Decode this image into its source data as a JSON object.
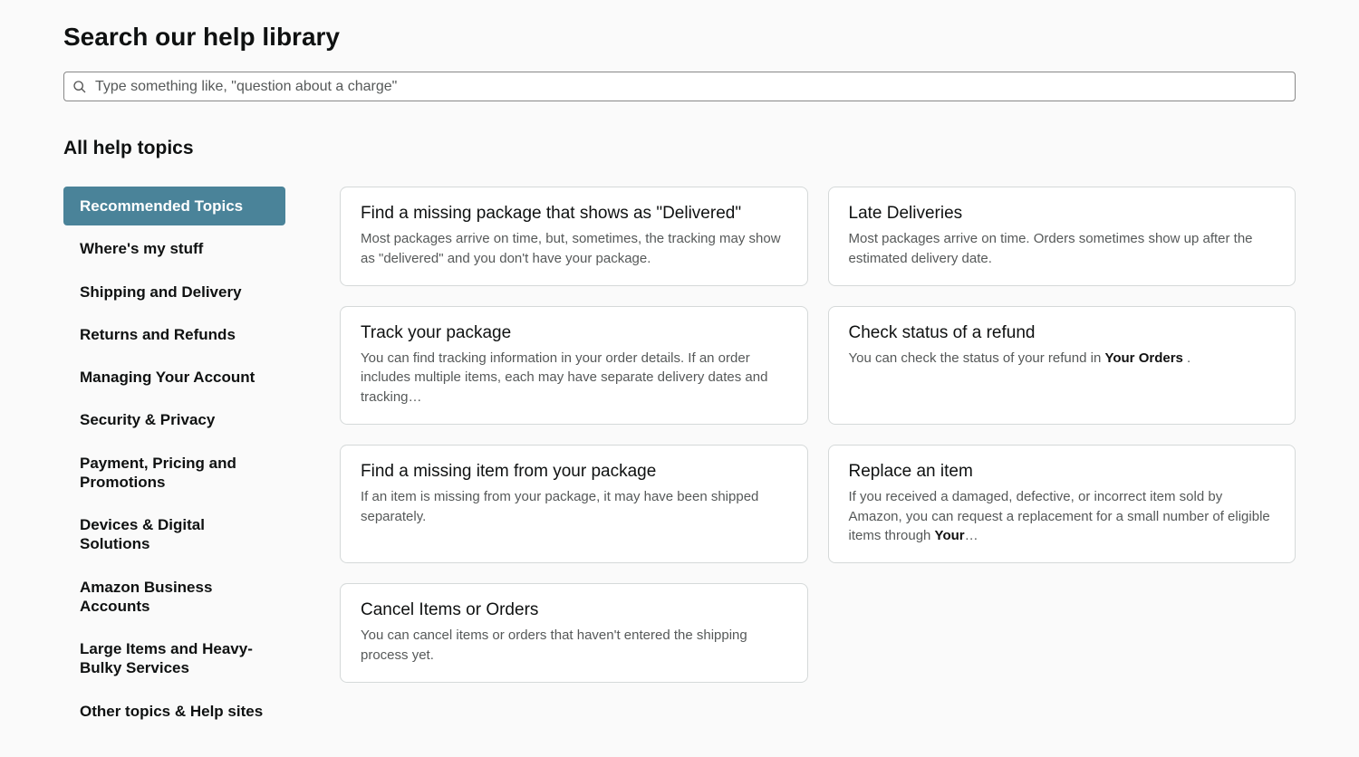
{
  "header": {
    "title": "Search our help library"
  },
  "search": {
    "placeholder": "Type something like, \"question about a charge\""
  },
  "section_title": "All help topics",
  "sidebar": {
    "items": [
      {
        "label": "Recommended Topics",
        "active": true
      },
      {
        "label": "Where's my stuff",
        "active": false
      },
      {
        "label": "Shipping and Delivery",
        "active": false
      },
      {
        "label": "Returns and Refunds",
        "active": false
      },
      {
        "label": "Managing Your Account",
        "active": false
      },
      {
        "label": "Security & Privacy",
        "active": false
      },
      {
        "label": "Payment, Pricing and Promotions",
        "active": false
      },
      {
        "label": "Devices & Digital Solutions",
        "active": false
      },
      {
        "label": "Amazon Business Accounts",
        "active": false
      },
      {
        "label": "Large Items and Heavy-Bulky Services",
        "active": false
      },
      {
        "label": "Other topics & Help sites",
        "active": false
      }
    ]
  },
  "cards": [
    {
      "title": "Find a missing package that shows as \"Delivered\"",
      "desc": "Most packages arrive on time, but, sometimes, the tracking may show as \"delivered\" and you don't have your package."
    },
    {
      "title": "Late Deliveries",
      "desc": "Most packages arrive on time. Orders sometimes show up after the estimated delivery date."
    },
    {
      "title": "Track your package",
      "desc": "You can find tracking information in your order details. If an order includes multiple items, each may have separate delivery dates and tracking…"
    },
    {
      "title": "Check status of a refund",
      "desc_pre": "You can check the status of your refund in ",
      "desc_bold": "Your Orders",
      "desc_post": " ."
    },
    {
      "title": "Find a missing item from your package",
      "desc": "If an item is missing from your package, it may have been shipped separately."
    },
    {
      "title": "Replace an item",
      "desc_pre": "If you received a damaged, defective, or incorrect item sold by Amazon, you can request a replacement for a small number of eligible items through ",
      "desc_bold": "Your",
      "desc_post": "…"
    },
    {
      "title": "Cancel Items or Orders",
      "desc": "You can cancel items or orders that haven't entered the shipping process yet."
    }
  ]
}
